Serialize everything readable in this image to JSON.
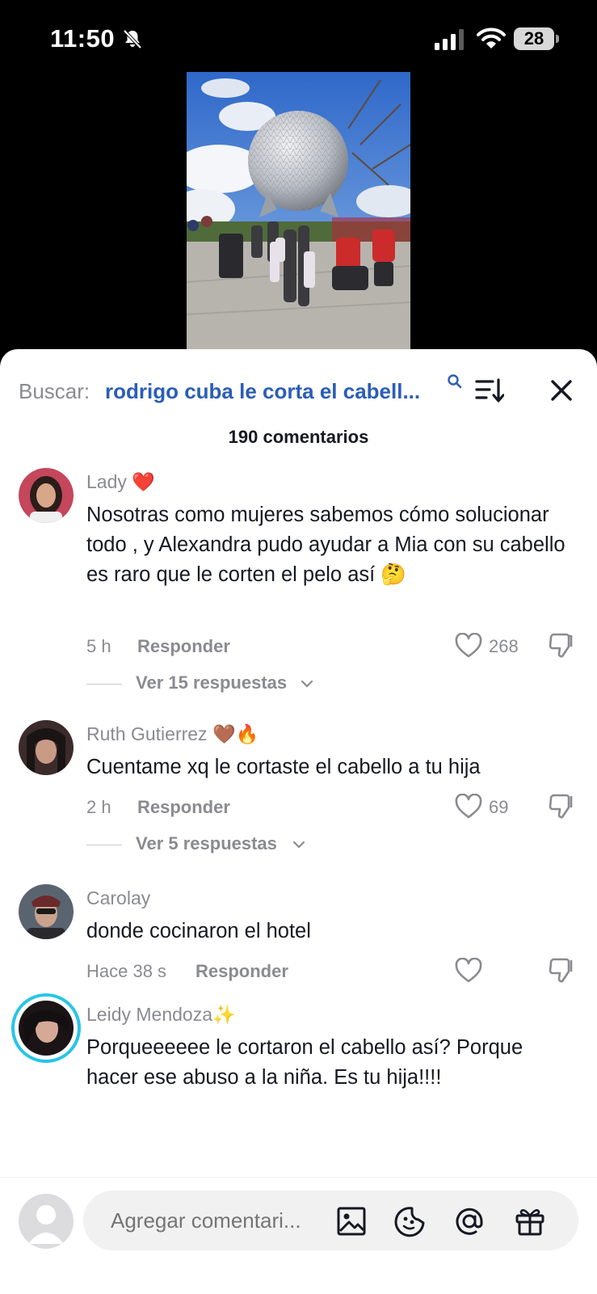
{
  "status": {
    "time": "11:50",
    "battery": "28"
  },
  "search": {
    "prefix": "Buscar:",
    "query": "rodrigo cuba le corta el cabell..."
  },
  "comments_count": "190 comentarios",
  "comments": [
    {
      "username": "Lady ❤️",
      "text": "Nosotras como mujeres sabemos cómo solucionar todo , y Alexandra pudo ayudar a Mia con su cabello es raro que le corten el pelo así 🤔",
      "time": "5 h",
      "reply": "Responder",
      "likes": "268",
      "replies": "Ver 15 respuestas"
    },
    {
      "username": "Ruth Gutierrez 🤎🔥",
      "text": "Cuentame xq le cortaste el cabello a tu hija",
      "time": "2 h",
      "reply": "Responder",
      "likes": "69",
      "replies": "Ver 5 respuestas"
    },
    {
      "username": "Carolay",
      "text": "donde cocinaron el hotel",
      "time": "Hace 38 s",
      "reply": "Responder",
      "likes": ""
    },
    {
      "username": "Leidy Mendoza✨",
      "text": "Porqueeeeee le cortaron el cabello así? Porque hacer ese abuso a la niña. Es tu hija!!!!"
    }
  ],
  "composer": {
    "placeholder": "Agregar comentari..."
  },
  "colors": {
    "link": "#2b5db8",
    "muted": "#8a8b91",
    "text": "#161823",
    "story_ring": "#27c5e6"
  }
}
